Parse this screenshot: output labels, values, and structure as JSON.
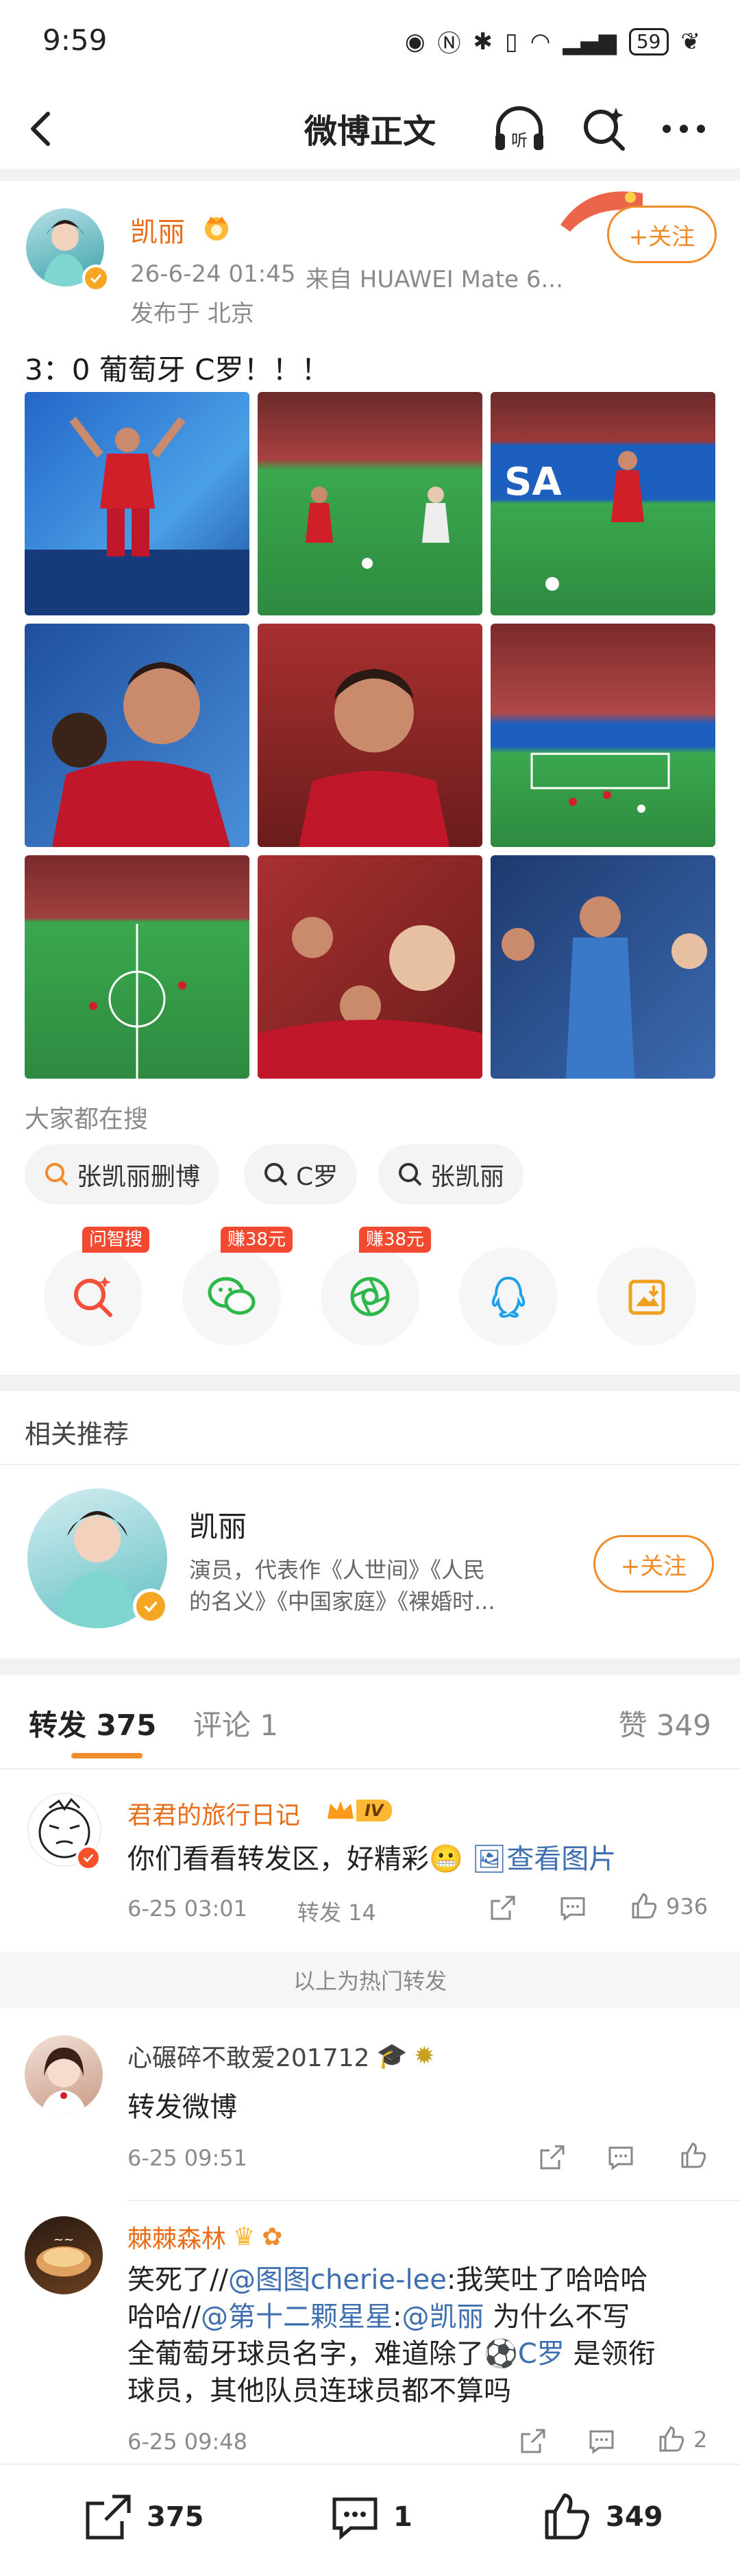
{
  "status_bar": {
    "time": "9:59",
    "battery": "59"
  },
  "nav": {
    "title": "微博正文"
  },
  "post": {
    "author": "凯丽",
    "timestamp": "26-6-24 01:45",
    "source": "来自 HUAWEI Mate 6...",
    "location": "发布于 北京",
    "follow_label": "+关注",
    "text": "3：0 葡萄牙 C罗！！！"
  },
  "search": {
    "label": "大家都在搜",
    "chips": [
      "张凯丽删博",
      "C罗",
      "张凯丽"
    ]
  },
  "share": {
    "badges": [
      "问智搜",
      "赚38元",
      "赚38元"
    ]
  },
  "related": {
    "label": "相关推荐",
    "name": "凯丽",
    "desc_line1": "演员，代表作《人世间》《人民",
    "desc_line2": "的名义》《中国家庭》《裸婚时...",
    "follow_label": "+关注"
  },
  "tabs": {
    "repost": "转发 375",
    "comment": "评论 1",
    "like": "赞 349"
  },
  "reposts": [
    {
      "name": "君君的旅行日记",
      "level": "IV",
      "text": "你们看看转发区，好精彩",
      "link": "查看图片",
      "time": "6-25 03:01",
      "reposts": "转发 14",
      "likes": "936"
    },
    {
      "name": "心碾碎不敢爱201712",
      "text": "转发微博",
      "time": "6-25 09:51"
    },
    {
      "name": "棘棘森林",
      "text_a": "笑死了//",
      "mention1": "@图图cherie-lee",
      "text_b": ":我笑吐了哈哈哈",
      "text_c": "哈哈//",
      "mention2": "@第十二颗星星",
      "text_d": ":",
      "mention3": "@凯丽",
      "text_e": " 为什么不写",
      "text_f": "全葡萄牙球员名字，难道除了",
      "mention4": "C罗",
      "text_g": " 是领衔",
      "text_h": "球员，其他队员连球员都不算吗",
      "time": "6-25 09:48",
      "likes": "2"
    }
  ],
  "hot_divider": "以上为热门转发",
  "bottom_bar": {
    "repost": "375",
    "comment": "1",
    "like": "349"
  },
  "colors": {
    "accent": "#f08c2a",
    "name_orange": "#e86d16",
    "link": "#3d6fb0",
    "badge_red": "#f24a30"
  }
}
